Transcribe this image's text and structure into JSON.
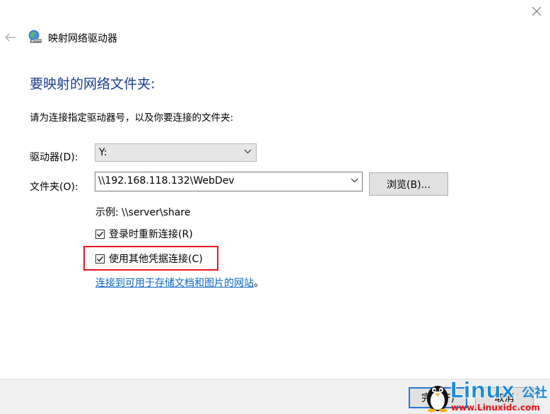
{
  "window": {
    "title": "映射网络驱动器"
  },
  "wizard": {
    "heading": "要映射的网络文件夹:",
    "instruction": "请为连接指定驱动器号，以及你要连接的文件夹:"
  },
  "form": {
    "drive_label": "驱动器(D):",
    "drive_value": "Y:",
    "folder_label": "文件夹(O):",
    "folder_value": "\\\\192.168.118.132\\WebDev",
    "browse_label": "浏览(B)...",
    "example_text": "示例: \\\\server\\share",
    "reconnect_label": "登录时重新连接(R)",
    "reconnect_checked": true,
    "credentials_label": "使用其他凭据连接(C)",
    "credentials_checked": true,
    "link_text": "连接到可用于存储文档和图片的网站",
    "link_suffix": "。"
  },
  "footer": {
    "finish_label": "完成(F)",
    "cancel_label": "取消"
  },
  "watermark": {
    "brand": "Linux",
    "suffix": "公社",
    "url": "www.Linuxidc.com"
  },
  "colors": {
    "heading": "#1a3e8c",
    "link": "#0b67c2",
    "highlight": "#e8141c",
    "focus": "#2479d6"
  },
  "icons": {
    "back": "back-arrow-icon",
    "close": "close-icon",
    "app": "network-drive-icon",
    "chevron": "chevron-down-icon",
    "check": "checkmark-icon"
  }
}
